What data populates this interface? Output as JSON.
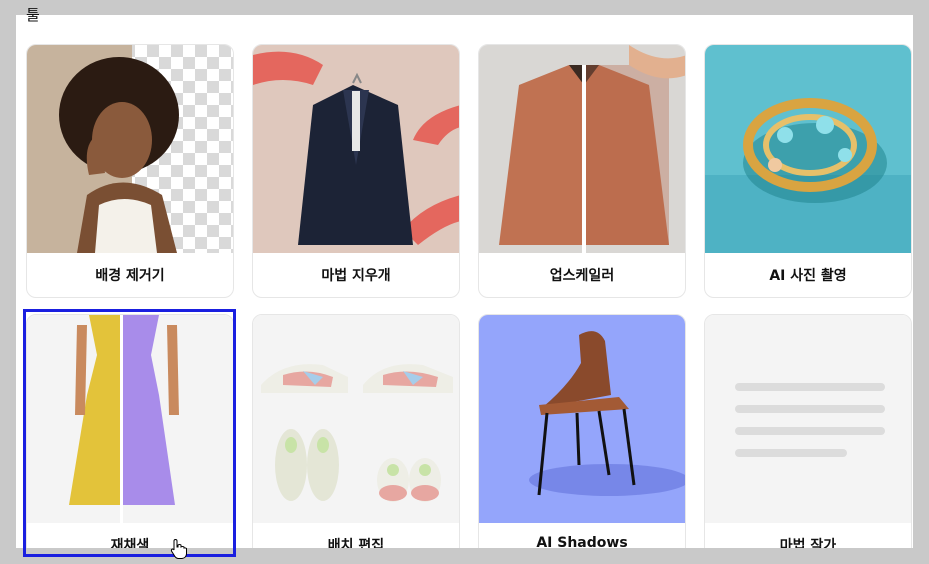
{
  "section": {
    "title": "툴"
  },
  "cards": [
    {
      "label": "배경 제거기"
    },
    {
      "label": "마법 지우개"
    },
    {
      "label": "업스케일러"
    },
    {
      "label": "AI 사진 촬영"
    },
    {
      "label": "재채색"
    },
    {
      "label": "배치 편집"
    },
    {
      "label": "AI Shadows"
    },
    {
      "label": "마법 작가"
    }
  ],
  "colors": {
    "selection_outline": "#1a1fe0",
    "ai_shadows_bg": "#94a5fb",
    "ai_photo_bg": "#5fc0cf"
  }
}
